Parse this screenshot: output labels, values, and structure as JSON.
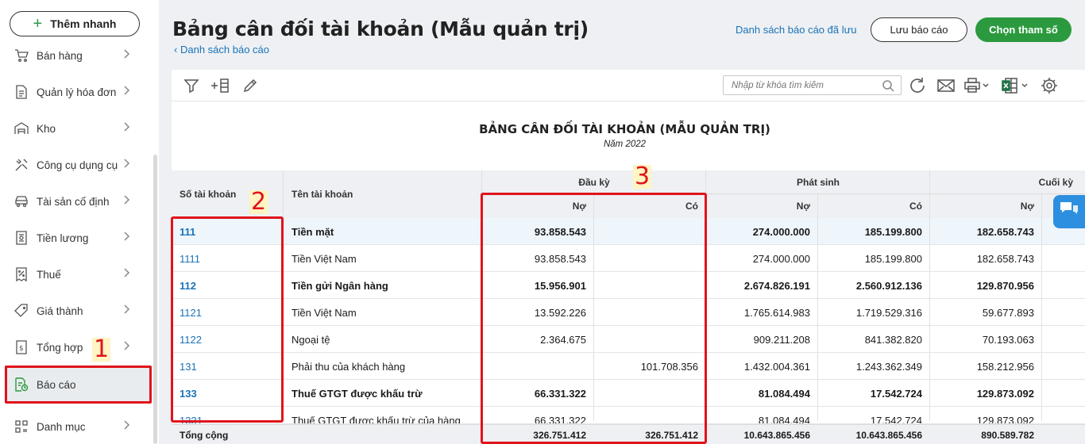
{
  "sidebar": {
    "quick_add": "Thêm nhanh",
    "items": [
      {
        "label": "Bán hàng",
        "icon": "cart-icon"
      },
      {
        "label": "Quản lý hóa đơn",
        "icon": "invoice-icon"
      },
      {
        "label": "Kho",
        "icon": "warehouse-icon"
      },
      {
        "label": "Công cụ dụng cụ",
        "icon": "tools-icon"
      },
      {
        "label": "Tài sản cố định",
        "icon": "car-icon"
      },
      {
        "label": "Tiền lương",
        "icon": "payroll-icon"
      },
      {
        "label": "Thuế",
        "icon": "tax-icon"
      },
      {
        "label": "Giá thành",
        "icon": "price-tag-icon"
      },
      {
        "label": "Tổng hợp",
        "icon": "ledger-icon"
      },
      {
        "label": "Báo cáo",
        "icon": "report-icon",
        "active": true
      },
      {
        "label": "Danh mục",
        "icon": "grid-icon"
      }
    ]
  },
  "header": {
    "title": "Bảng cân đối tài khoản (Mẫu quản trị)",
    "back_link": "Danh sách báo cáo",
    "saved_link": "Danh sách báo cáo đã lưu",
    "save_button": "Lưu báo cáo",
    "param_button": "Chọn tham số"
  },
  "toolbar": {
    "search_placeholder": "Nhập từ khóa tìm kiếm",
    "icons": [
      "filter-icon",
      "add-column-icon",
      "edit-icon",
      "search-icon",
      "refresh-icon",
      "email-icon",
      "print-icon",
      "excel-icon",
      "settings-icon"
    ]
  },
  "report": {
    "title": "BẢNG CÂN ĐỐI TÀI KHOẢN (MẪU QUẢN TRỊ)",
    "subtitle": "Năm 2022",
    "headers": {
      "account_no": "Số tài khoản",
      "account_name": "Tên tài khoản",
      "opening": "Đầu kỳ",
      "period": "Phát sinh",
      "closing": "Cuối kỳ",
      "debit": "Nợ",
      "credit": "Có"
    },
    "rows": [
      {
        "code": "111",
        "name": "Tiền mặt",
        "od": "93.858.543",
        "oc": "",
        "pd": "274.000.000",
        "pc": "185.199.800",
        "cd": "182.658.743",
        "bold": true
      },
      {
        "code": "1111",
        "name": "Tiền Việt Nam",
        "od": "93.858.543",
        "oc": "",
        "pd": "274.000.000",
        "pc": "185.199.800",
        "cd": "182.658.743",
        "bold": false
      },
      {
        "code": "112",
        "name": "Tiền gửi Ngân hàng",
        "od": "15.956.901",
        "oc": "",
        "pd": "2.674.826.191",
        "pc": "2.560.912.136",
        "cd": "129.870.956",
        "bold": true
      },
      {
        "code": "1121",
        "name": "Tiền Việt Nam",
        "od": "13.592.226",
        "oc": "",
        "pd": "1.765.614.983",
        "pc": "1.719.529.316",
        "cd": "59.677.893",
        "bold": false
      },
      {
        "code": "1122",
        "name": "Ngoại tệ",
        "od": "2.364.675",
        "oc": "",
        "pd": "909.211.208",
        "pc": "841.382.820",
        "cd": "70.193.063",
        "bold": false
      },
      {
        "code": "131",
        "name": "Phải thu của khách hàng",
        "od": "",
        "oc": "101.708.356",
        "pd": "1.432.004.361",
        "pc": "1.243.362.349",
        "cd": "158.212.956",
        "bold": false
      },
      {
        "code": "133",
        "name": "Thuế GTGT được khấu trừ",
        "od": "66.331.322",
        "oc": "",
        "pd": "81.084.494",
        "pc": "17.542.724",
        "cd": "129.873.092",
        "bold": true
      },
      {
        "code": "1331",
        "name": "Thuế GTGT được khấu trừ của hàng",
        "od": "66.331.322",
        "oc": "",
        "pd": "81.084.494",
        "pc": "17.542.724",
        "cd": "129.873.092",
        "bold": false
      }
    ],
    "total": {
      "label": "Tổng cộng",
      "od": "326.751.412",
      "oc": "326.751.412",
      "pd": "10.643.865.456",
      "pc": "10.643.865.456",
      "cd": "890.589.782"
    }
  },
  "annotations": [
    "1",
    "2",
    "3"
  ],
  "colors": {
    "accent_green": "#2b9a3e",
    "link_blue": "#1a73b8",
    "annotation_red": "#e0131b"
  }
}
